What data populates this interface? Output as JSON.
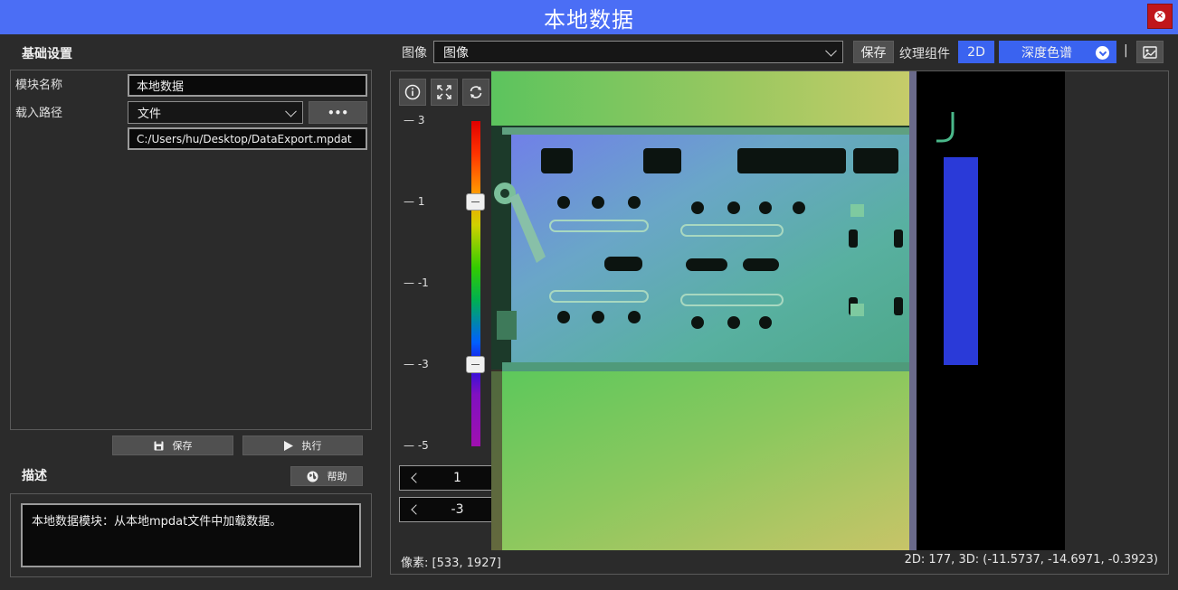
{
  "window": {
    "title": "本地数据"
  },
  "left": {
    "basic_title": "基础设置",
    "module_name_label": "模块名称",
    "module_name_value": "本地数据",
    "load_path_label": "载入路径",
    "load_path_type": "文件",
    "browse_label": "•••",
    "path_value": "C:/Users/hu/Desktop/DataExport.mpdat",
    "save_label": "保存",
    "run_label": "执行",
    "desc_title": "描述",
    "help_label": "帮助",
    "description": "本地数据模块：从本地mpdat文件中加载数据。"
  },
  "toolbar": {
    "image_label": "图像",
    "image_select": "图像",
    "save_label": "保存",
    "texture_label": "纹理组件",
    "mode_label": "2D",
    "colormap_label": "深度色谱",
    "separator": "|"
  },
  "scale": {
    "ticks": [
      "3",
      "1",
      "-1",
      "-3",
      "-5"
    ],
    "upper_handle": 1,
    "lower_handle": -3
  },
  "spinners": {
    "upper_value": "1",
    "lower_value": "-3"
  },
  "status": {
    "pixel": "像素: [533, 1927]",
    "coords": "2D: 177, 3D: (-11.5737, -14.6971, -0.3923)"
  },
  "colors": {
    "titlebar": "#4b6ef5",
    "accent": "#3a63f0",
    "close": "#c0161b"
  },
  "icons": [
    "info-icon",
    "fit-view-icon",
    "refresh-icon",
    "image-save-icon",
    "save-icon",
    "play-icon",
    "globe-icon",
    "close-icon"
  ]
}
